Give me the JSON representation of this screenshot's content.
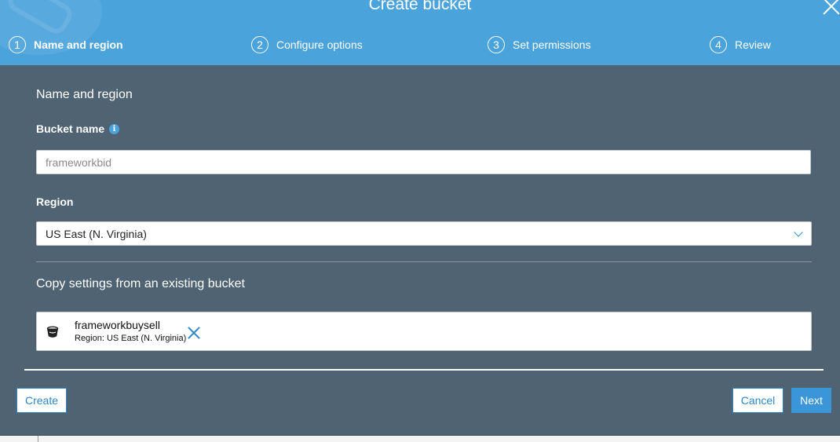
{
  "modal": {
    "title": "Create bucket",
    "steps": [
      {
        "number": "1",
        "label": "Name and region",
        "active": true
      },
      {
        "number": "2",
        "label": "Configure options",
        "active": false
      },
      {
        "number": "3",
        "label": "Set permissions",
        "active": false
      },
      {
        "number": "4",
        "label": "Review",
        "active": false
      }
    ]
  },
  "form": {
    "section_heading": "Name and region",
    "bucket_name": {
      "label": "Bucket name",
      "value": "",
      "placeholder": "frameworkbid"
    },
    "region": {
      "label": "Region",
      "selected": "US East (N. Virginia)"
    },
    "copy_settings": {
      "heading": "Copy settings from an existing bucket",
      "bucket_name": "frameworkbuysell",
      "bucket_region": "Region: US East (N. Virginia)"
    }
  },
  "footer": {
    "create_label": "Create",
    "cancel_label": "Cancel",
    "next_label": "Next"
  },
  "colors": {
    "header": "#4ba3dc",
    "body": "#4f6372",
    "accent": "#2c86c7",
    "primary_button": "#3b95d9"
  }
}
